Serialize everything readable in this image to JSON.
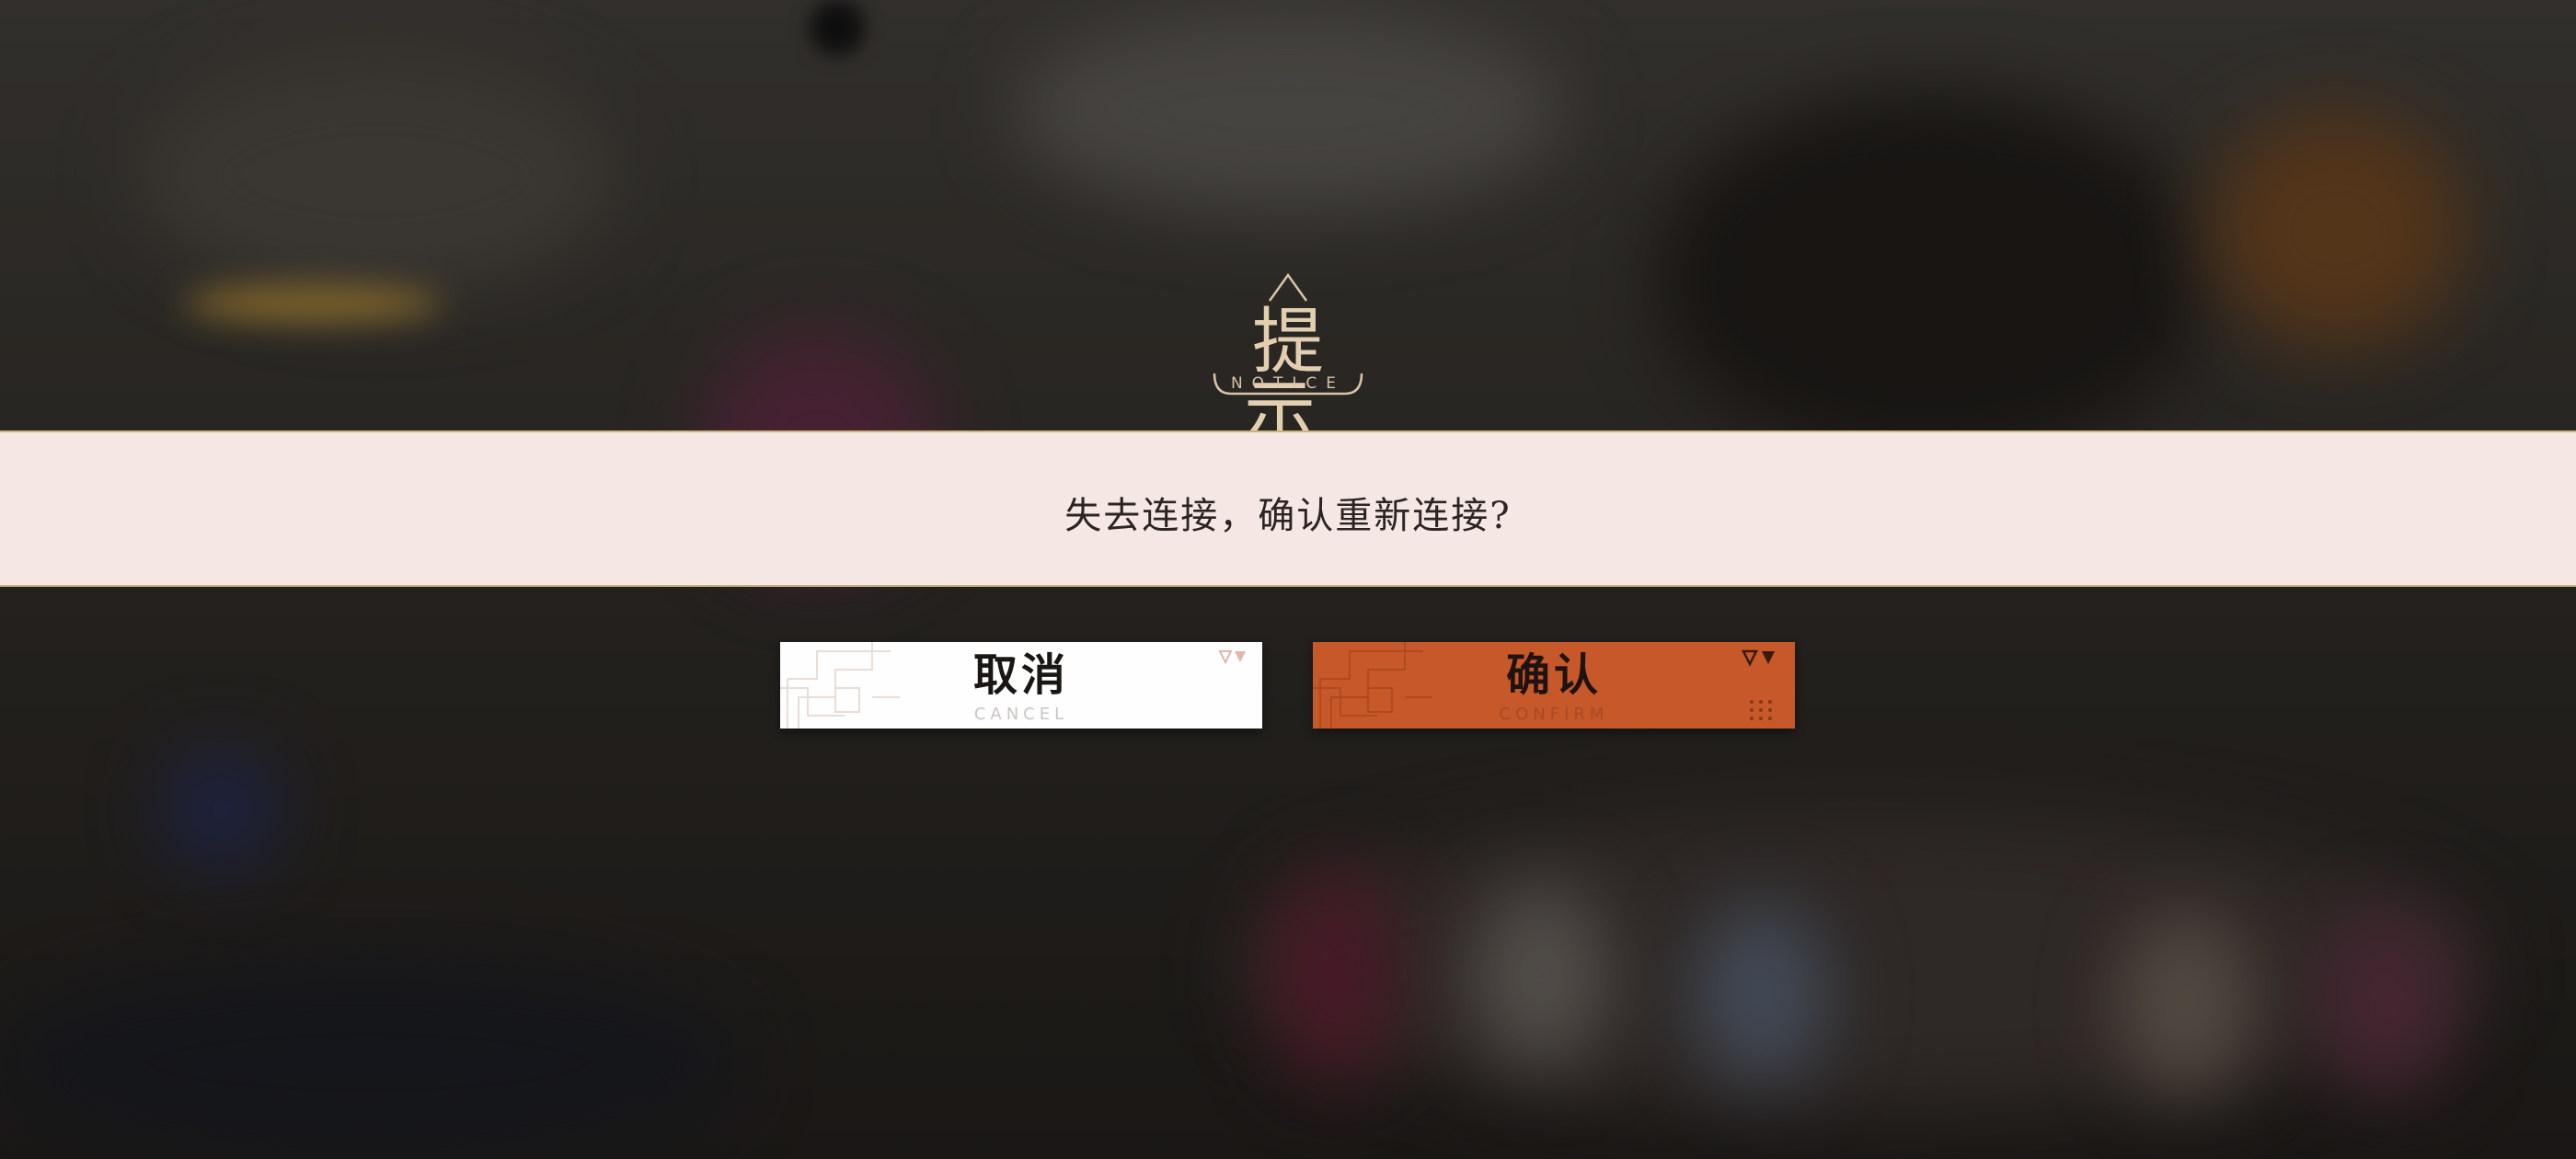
{
  "dialog": {
    "title": "提示",
    "title_sub": "NOTICE",
    "message": "失去连接，确认重新连接?"
  },
  "buttons": {
    "cancel": {
      "label": "取消",
      "sub": "CANCEL"
    },
    "confirm": {
      "label": "确认",
      "sub": "CONFIRM"
    }
  },
  "colors": {
    "band": "#f5e7e3",
    "accent_gold": "#c9b27f",
    "confirm": "#c6582a",
    "cancel": "#fefefe"
  },
  "icons": [
    "triangle-marker-icon",
    "dot-grid-icon",
    "circuit-deco-icon"
  ]
}
